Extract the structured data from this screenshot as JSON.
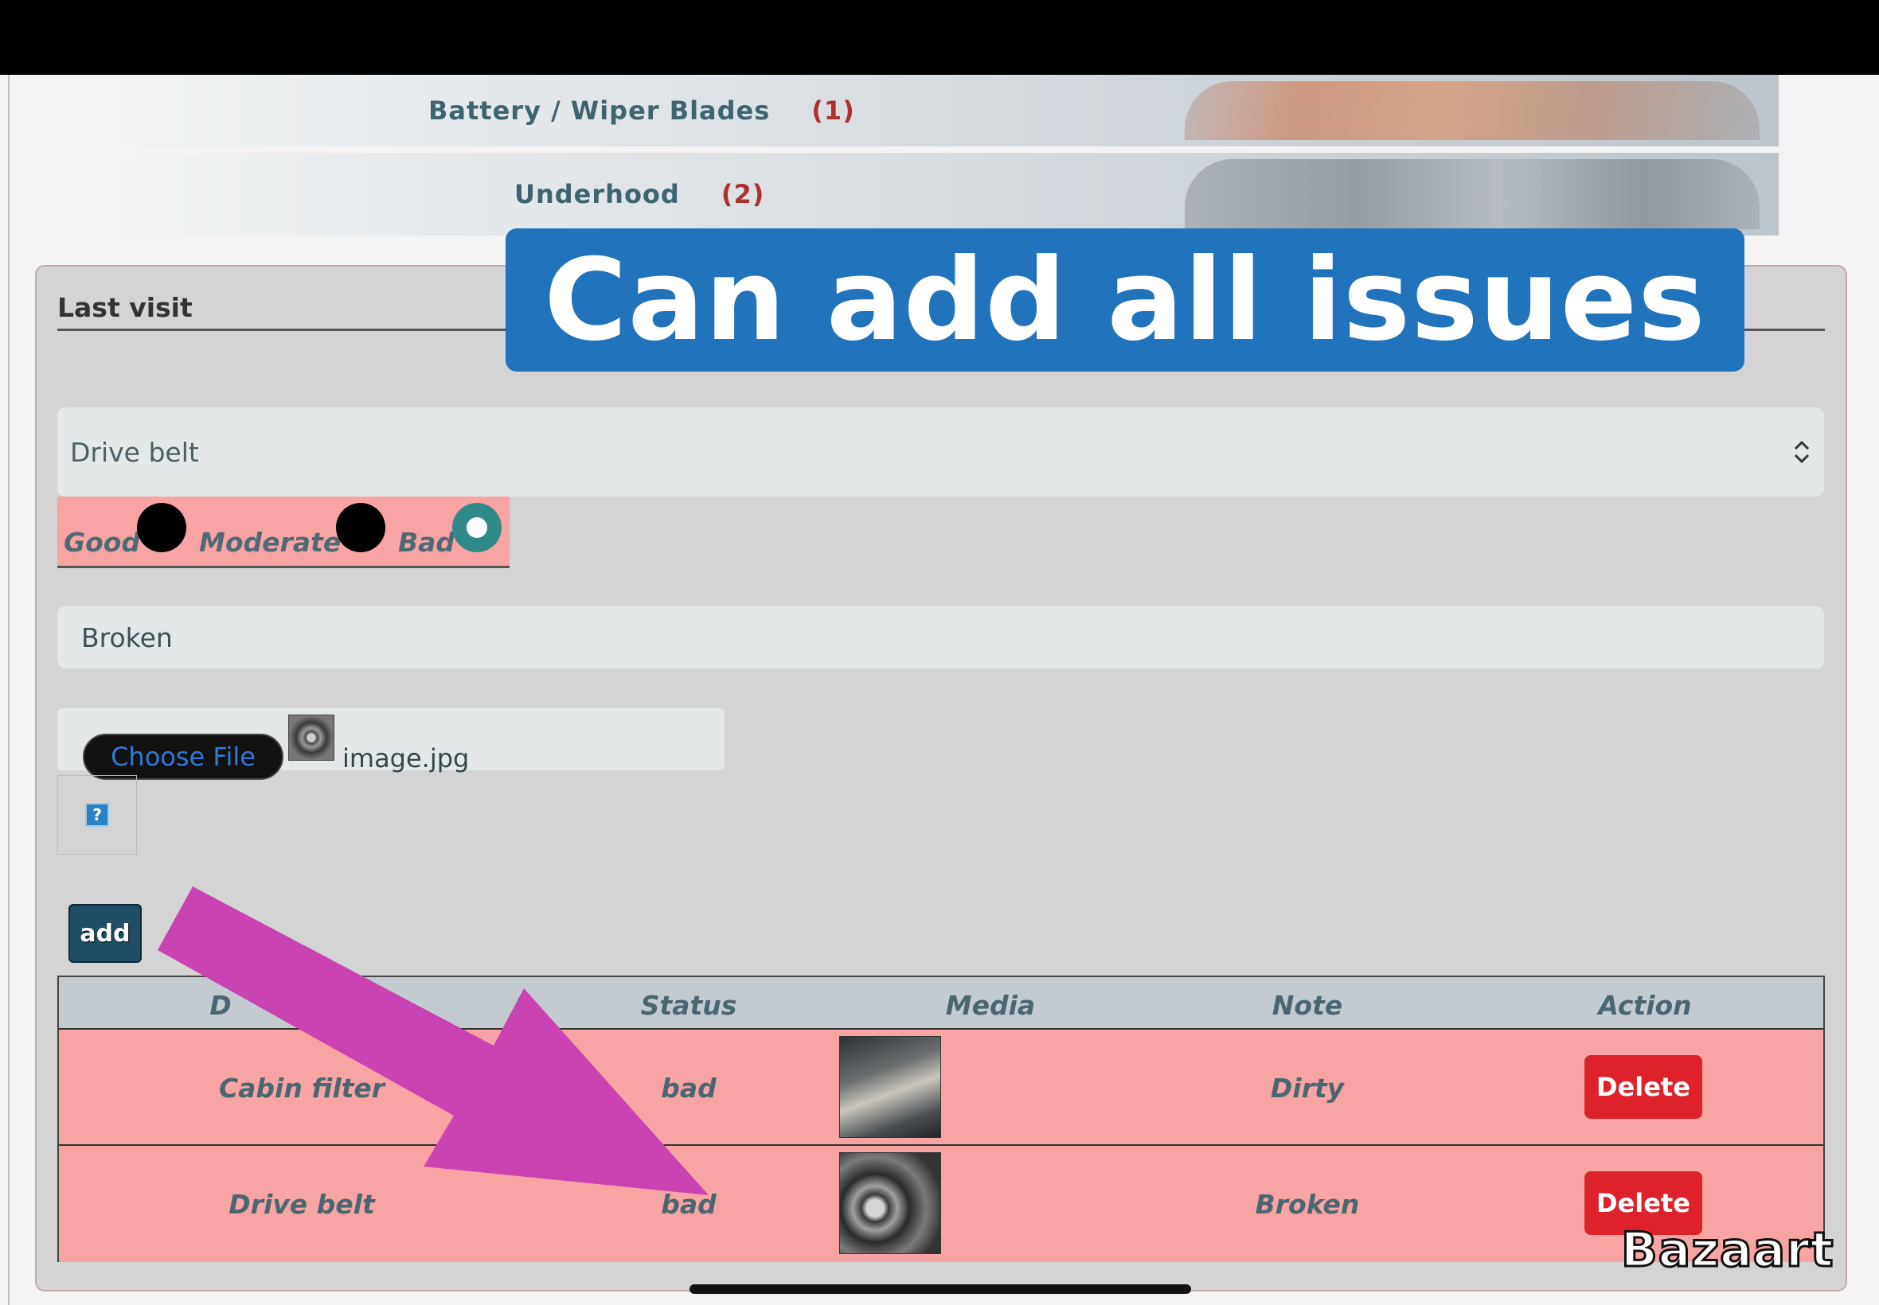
{
  "categories": [
    {
      "label": "Battery / Wiper Blades",
      "count": "(1)"
    },
    {
      "label": "Underhood",
      "count": "(2)"
    }
  ],
  "overlay_caption": "Can add all issues",
  "card": {
    "title": "Last visit"
  },
  "form": {
    "component_select": {
      "value": "Drive belt"
    },
    "status_options": [
      {
        "label": "Good",
        "selected": false
      },
      {
        "label": "Moderate",
        "selected": false
      },
      {
        "label": "Bad",
        "selected": true
      }
    ],
    "note_value": "Broken",
    "file": {
      "button_label": "Choose File",
      "file_name": "image.jpg"
    },
    "help_icon": "?",
    "add_label": "add"
  },
  "table": {
    "headers": [
      "D",
      "Status",
      "Media",
      "Note",
      "Action"
    ],
    "rows": [
      {
        "item": "Cabin filter",
        "status": "bad",
        "media": "cabin-filter-photo",
        "note": "Dirty",
        "action": "Delete"
      },
      {
        "item": "Drive belt",
        "status": "bad",
        "media": "drive-belt-photo",
        "note": "Broken",
        "action": "Delete"
      }
    ]
  },
  "watermark": "Bazaart",
  "colors": {
    "overlay_bg": "#2174bb",
    "row_bad_bg": "#f8a4a4",
    "delete_bg": "#dd2329",
    "arrow": "#c943b3",
    "radio_selected": "#2f8a88"
  }
}
